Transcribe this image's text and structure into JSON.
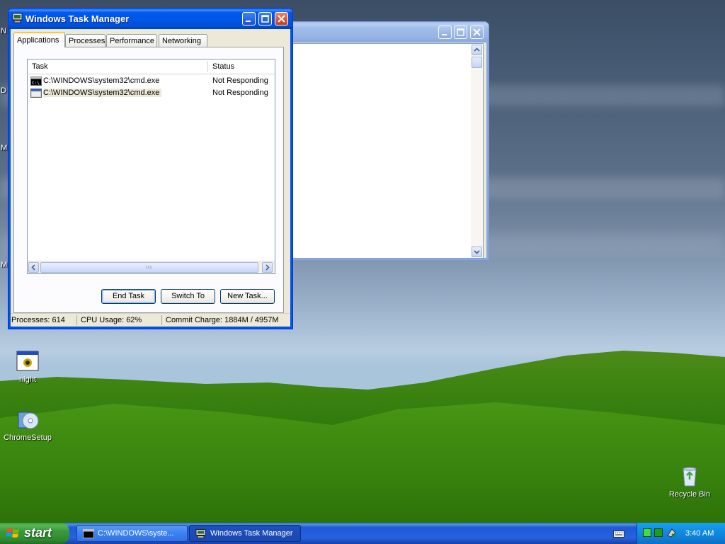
{
  "desktop": {
    "left_edge_chars": [
      "N",
      "D",
      "M",
      "M"
    ],
    "icons": [
      {
        "name": "night",
        "label": "night"
      },
      {
        "name": "chromesetup",
        "label": "ChromeSetup"
      },
      {
        "name": "recycle-bin",
        "label": "Recycle Bin"
      }
    ]
  },
  "task_manager": {
    "title": "Windows Task Manager",
    "tabs": [
      "Applications",
      "Processes",
      "Performance",
      "Networking"
    ],
    "active_tab": "Applications",
    "columns": [
      "Task",
      "Status"
    ],
    "rows": [
      {
        "task": "C:\\WINDOWS\\system32\\cmd.exe",
        "status": "Not Responding"
      },
      {
        "task": "C:\\WINDOWS\\system32\\cmd.exe",
        "status": "Not Responding"
      }
    ],
    "buttons": {
      "end_task": "End Task",
      "switch_to": "Switch To",
      "new_task": "New Task..."
    },
    "status": {
      "processes": "Processes: 614",
      "cpu": "CPU Usage: 62%",
      "commit": "Commit Charge: 1884M / 4957M"
    }
  },
  "taskbar": {
    "start_label": "start",
    "items": [
      {
        "label": "C:\\WINDOWS\\syste...",
        "icon": "cmd-icon"
      },
      {
        "label": "Windows Task Manager",
        "icon": "task-manager-icon"
      }
    ],
    "clock": "3:40 AM"
  },
  "colors": {
    "xp_blue": "#0055e5",
    "start_green": "#3a9a3a",
    "tray_blue": "#0f7fd7"
  }
}
